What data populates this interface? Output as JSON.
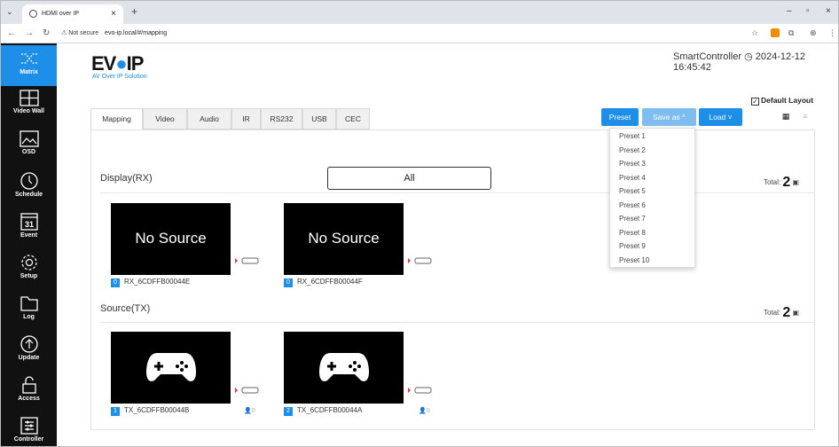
{
  "browser": {
    "tab_title": "HDMI over IP",
    "url_warning": "Not secure",
    "url": "evo-ip.local/#/mapping"
  },
  "sidebar": {
    "items": [
      {
        "label": "Matrix",
        "icon": "shuffle-icon"
      },
      {
        "label": "Video Wall",
        "icon": "grid-icon"
      },
      {
        "label": "OSD",
        "icon": "image-icon"
      },
      {
        "label": "Schedule",
        "icon": "clock-icon"
      },
      {
        "label": "Event",
        "icon": "calendar-icon",
        "badge": "31"
      },
      {
        "label": "Setup",
        "icon": "gear-icon"
      },
      {
        "label": "Log",
        "icon": "folder-icon"
      },
      {
        "label": "Update",
        "icon": "upload-icon"
      },
      {
        "label": "Access",
        "icon": "lock-icon"
      },
      {
        "label": "Controller",
        "icon": "sliders-icon"
      }
    ]
  },
  "header": {
    "logo": "EV●IP",
    "logo_sub": "AV Over IP Solution",
    "controller": "SmartController ◷ 2024-12-12 16:45:42",
    "default_layout": "Default Layout"
  },
  "tabs": [
    "Mapping",
    "Video",
    "Audio",
    "IR",
    "RS232",
    "USB",
    "CEC"
  ],
  "toolbar": {
    "preset": "Preset",
    "save_as": "Save as ^",
    "load": "Load ˅"
  },
  "presets": [
    "Preset 1",
    "Preset 2",
    "Preset 3",
    "Preset 4",
    "Preset 5",
    "Preset 6",
    "Preset 7",
    "Preset 8",
    "Preset 9",
    "Preset 10"
  ],
  "display": {
    "title": "Display(RX)",
    "filter": "All",
    "total_label": "Total:",
    "total": "2",
    "devices": [
      {
        "num": "0",
        "name": "RX_6CDFFB00044E",
        "screen": "No Source"
      },
      {
        "num": "0",
        "name": "RX_6CDFFB00044F",
        "screen": "No Source"
      }
    ]
  },
  "source": {
    "title": "Source(TX)",
    "total_label": "Total:",
    "total": "2",
    "devices": [
      {
        "num": "1",
        "name": "TX_6CDFFB00044B",
        "users": "0"
      },
      {
        "num": "2",
        "name": "TX_6CDFFB00044A",
        "users": "0"
      }
    ]
  },
  "colors": {
    "accent": "#1e8fe8",
    "sidebar": "#111111"
  }
}
